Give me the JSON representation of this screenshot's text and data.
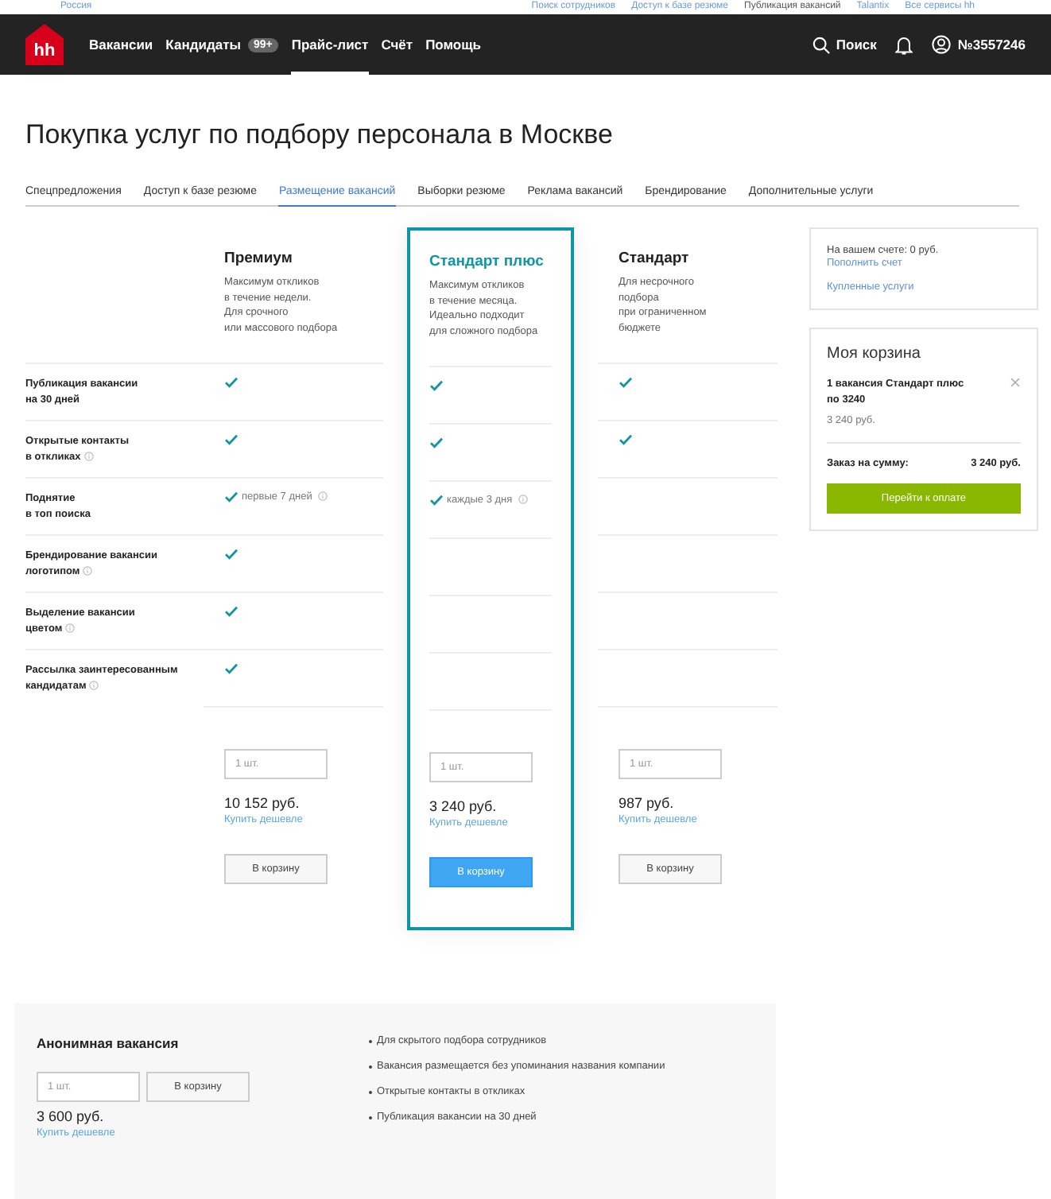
{
  "top_links": [
    {
      "label": "Россия",
      "selected": false
    },
    {
      "label": "Поиск сотрудников",
      "selected": false
    },
    {
      "label": "Доступ к базе резюме",
      "selected": false
    },
    {
      "label": "Публикация вакансий",
      "selected": true
    },
    {
      "label": "Talantix",
      "selected": false
    },
    {
      "label": "Все сервисы hh",
      "selected": false
    }
  ],
  "nav": {
    "logo": "hh",
    "items": [
      {
        "label": "Вакансии",
        "selected": false
      },
      {
        "label": "Кандидаты",
        "selected": false,
        "badge": "99+"
      },
      {
        "label": "Прайс-лист",
        "selected": true
      },
      {
        "label": "Счёт",
        "selected": false
      },
      {
        "label": "Помощь",
        "selected": false
      }
    ],
    "search": "Поиск",
    "account": "№3557246"
  },
  "title": "Покупка услуг по подбору персонала в Москве",
  "tabs": [
    {
      "label": "Спецпредложения",
      "selected": false
    },
    {
      "label": "Доступ к базе резюме",
      "selected": false
    },
    {
      "label": "Размещение вакансий",
      "selected": true
    },
    {
      "label": "Выборки резюме",
      "selected": false
    },
    {
      "label": "Реклама вакансий",
      "selected": false
    },
    {
      "label": "Брендирование",
      "selected": false
    },
    {
      "label": "Дополнительные услуги",
      "selected": false
    }
  ],
  "features": [
    {
      "label": "Публикация вакансии\nна 30 дней",
      "info": false
    },
    {
      "label": "Открытые контакты\nв откликах",
      "info": true
    },
    {
      "label": "Поднятие\nв топ поиска",
      "info": false
    },
    {
      "label": "Брендирование вакансии\nлоготипом",
      "info": true
    },
    {
      "label": "Выделение вакансии\nцветом",
      "info": true
    },
    {
      "label": "Рассылка заинтересованным\nкандидатам",
      "info": true
    }
  ],
  "plans": [
    {
      "name": "Премиум",
      "highlighted": false,
      "description": "Максимум откликов\nв течение недели.\nДля срочного\nили массового подбора",
      "cells": [
        {
          "included": true
        },
        {
          "included": true
        },
        {
          "included": true,
          "note": "первые 7 дней"
        },
        {
          "included": true
        },
        {
          "included": true
        },
        {
          "included": true
        }
      ],
      "quantity_placeholder": "1 шт.",
      "price": "10 152 руб.",
      "cheaper_link": "Купить дешевле",
      "button": "В корзину"
    },
    {
      "name": "Стандарт плюс",
      "highlighted": true,
      "description": "Максимум откликов\nв течение месяца.\nИдеально подходит\nдля сложного подбора",
      "cells": [
        {
          "included": true
        },
        {
          "included": true
        },
        {
          "included": true,
          "note": "каждые 3 дня"
        },
        {
          "included": false
        },
        {
          "included": false
        },
        {
          "included": false
        }
      ],
      "quantity_placeholder": "1 шт.",
      "price": "3 240 руб.",
      "cheaper_link": "Купить дешевле",
      "button": "В корзину"
    },
    {
      "name": "Стандарт",
      "highlighted": false,
      "description": "Для несрочного\nподбора\nпри ограниченном\nбюджете",
      "cells": [
        {
          "included": true
        },
        {
          "included": true
        },
        {
          "included": false
        },
        {
          "included": false
        },
        {
          "included": false
        },
        {
          "included": false
        }
      ],
      "quantity_placeholder": "1 шт.",
      "price": "987 руб.",
      "cheaper_link": "Купить дешевле",
      "button": "В корзину"
    }
  ],
  "account": {
    "balance": "На вашем счете: 0 руб.",
    "top_up": "Пополнить счет",
    "purchased": "Купленные услуги"
  },
  "cart": {
    "title": "Моя корзина",
    "items": [
      {
        "name": "1 вакансия Стандарт плюс\nпо 3240",
        "price": "3 240 руб."
      }
    ],
    "total_label": "Заказ на сумму:",
    "total": "3 240 руб.",
    "checkout": "Перейти к оплате"
  },
  "anonymous": {
    "title": "Анонимная вакансия",
    "quantity_placeholder": "1 шт.",
    "button": "В корзину",
    "price": "3 600 руб.",
    "cheaper_link": "Купить дешевле",
    "bullets": [
      "Для скрытого подбора сотрудников",
      "Вакансия размещается без упоминания названия компании",
      "Открытые контакты в откликах",
      "Публикация вакансии на 30 дней"
    ]
  }
}
